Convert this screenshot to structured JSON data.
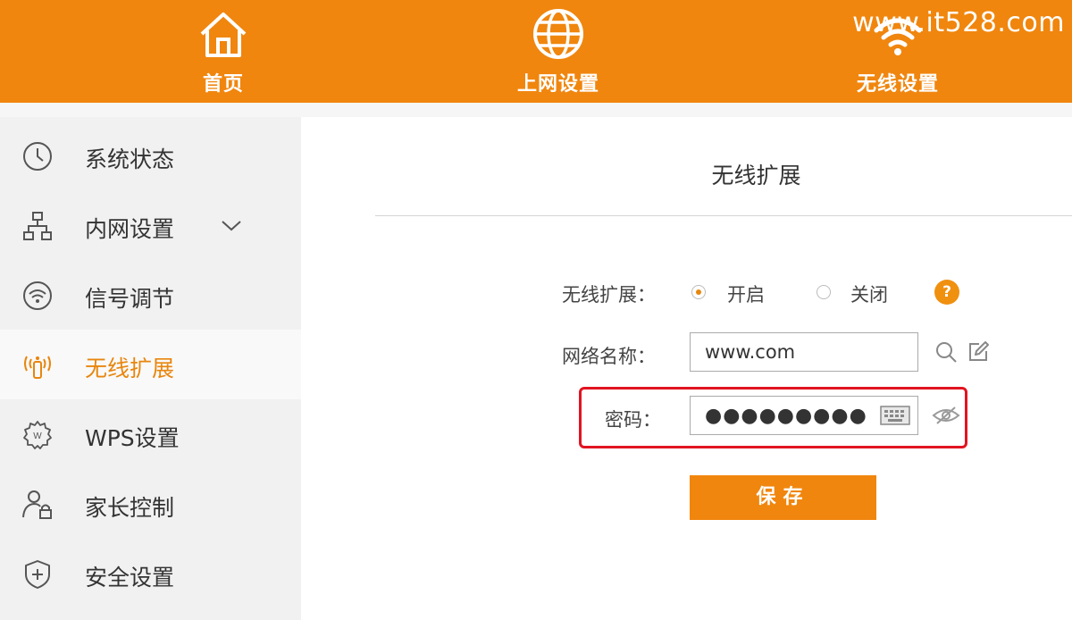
{
  "watermark": "www.it528.com",
  "topnav": {
    "home": {
      "label": "首页",
      "icon": "home-icon"
    },
    "internet": {
      "label": "上网设置",
      "icon": "globe-icon"
    },
    "wireless": {
      "label": "无线设置",
      "icon": "wifi-icon"
    }
  },
  "sidebar": {
    "items": [
      {
        "label": "系统状态",
        "icon": "clock-icon"
      },
      {
        "label": "内网设置",
        "icon": "network-icon",
        "expandable": true
      },
      {
        "label": "信号调节",
        "icon": "signal-icon"
      },
      {
        "label": "无线扩展",
        "icon": "antenna-icon",
        "active": true
      },
      {
        "label": "WPS设置",
        "icon": "wps-gear-icon"
      },
      {
        "label": "家长控制",
        "icon": "parent-lock-icon"
      },
      {
        "label": "安全设置",
        "icon": "shield-icon"
      }
    ]
  },
  "main": {
    "title": "无线扩展",
    "extension": {
      "label": "无线扩展：",
      "options": [
        "开启",
        "关闭"
      ],
      "selected": "开启",
      "help": "?"
    },
    "ssid": {
      "label": "网络名称：",
      "value": "www.com"
    },
    "password": {
      "label": "密码：",
      "value": "●●●●●●●●●"
    },
    "save_label": "保存"
  },
  "colors": {
    "accent": "#f0860e",
    "highlight": "#e21420",
    "sidebar_bg": "#f1f1f1"
  }
}
